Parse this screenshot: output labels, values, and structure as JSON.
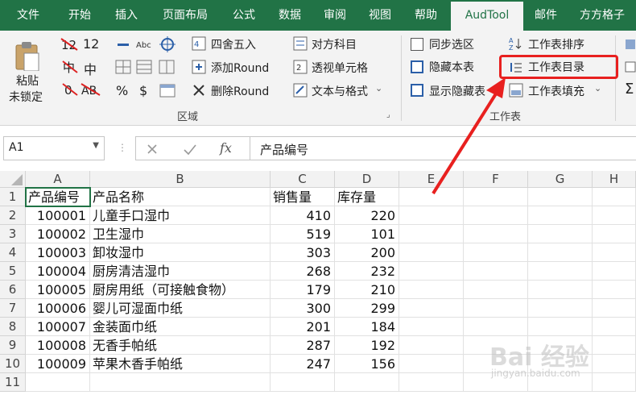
{
  "tabs": [
    "文件",
    "开始",
    "插入",
    "页面布局",
    "公式",
    "数据",
    "审阅",
    "视图",
    "帮助",
    "AudTool",
    "邮件",
    "方方格子"
  ],
  "active_tab": "AudTool",
  "ribbon": {
    "paste_line1": "粘贴",
    "paste_line2": "未锁定",
    "num_12": "12",
    "char_zhong": "中",
    "char_ab": "AB",
    "round_label": "四舍五入",
    "add_round": "添加Round",
    "del_round": "删除Round",
    "counter_subject": "对方科目",
    "pivot_cell": "透视单元格",
    "text_format": "文本与格式",
    "sync_select": "同步选区",
    "hide_sheet": "隐藏本表",
    "show_hidden": "显示隐藏表",
    "sheet_sort": "工作表排序",
    "sheet_toc": "工作表目录",
    "sheet_fill": "工作表填充",
    "group_area": "区域",
    "group_sheet": "工作表"
  },
  "formula_bar": {
    "cell_ref": "A1",
    "fx": "fx",
    "value": "产品编号"
  },
  "sheet": {
    "columns": [
      "A",
      "B",
      "C",
      "D",
      "E",
      "F",
      "G",
      "H"
    ],
    "row_numbers": [
      "1",
      "2",
      "3",
      "4",
      "5",
      "6",
      "7",
      "8",
      "9",
      "10",
      "11"
    ],
    "header": [
      "产品编号",
      "产品名称",
      "销售量",
      "库存量"
    ],
    "rows": [
      [
        "100001",
        "儿童手口湿巾",
        "410",
        "220"
      ],
      [
        "100002",
        "卫生湿巾",
        "519",
        "101"
      ],
      [
        "100003",
        "卸妆湿巾",
        "303",
        "200"
      ],
      [
        "100004",
        "厨房清洁湿巾",
        "268",
        "232"
      ],
      [
        "100005",
        "厨房用纸（可接触食物）",
        "179",
        "210"
      ],
      [
        "100006",
        "婴儿可湿面巾纸",
        "300",
        "299"
      ],
      [
        "100007",
        "金装面巾纸",
        "201",
        "184"
      ],
      [
        "100008",
        "无香手帕纸",
        "287",
        "192"
      ],
      [
        "100009",
        "苹果木香手帕纸",
        "247",
        "156"
      ]
    ]
  },
  "watermark": {
    "brand": "Bai 经验",
    "url": "jingyan.baidu.com"
  },
  "colors": {
    "ribbon_green": "#217346",
    "callout_red": "#e8201f"
  }
}
